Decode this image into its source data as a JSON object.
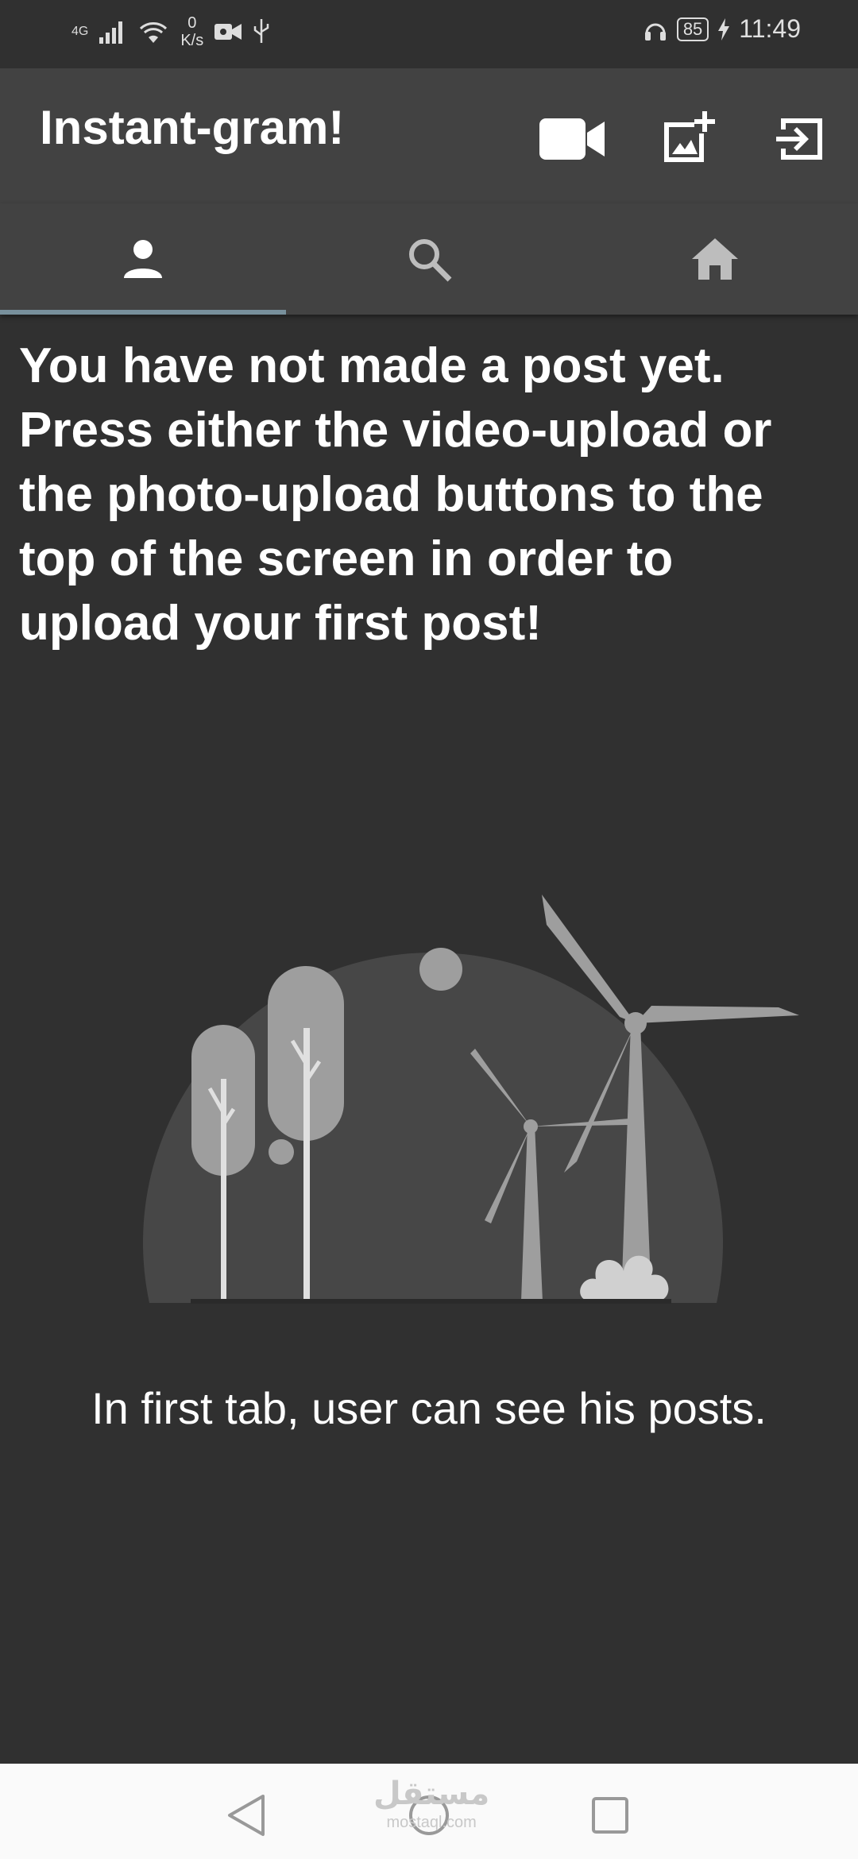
{
  "status_bar": {
    "network": "4G",
    "speed_value": "0",
    "speed_unit": "K/s",
    "battery": "85",
    "time": "11:49"
  },
  "app_bar": {
    "title": "Instant-gram!",
    "actions": [
      "videocam-icon",
      "add-photo-icon",
      "logout-icon"
    ]
  },
  "tabs": [
    {
      "icon": "person-icon",
      "active": true
    },
    {
      "icon": "search-icon",
      "active": false
    },
    {
      "icon": "home-icon",
      "active": false
    }
  ],
  "content": {
    "message": "You have not made a post yet. Press either the video-upload or the photo-upload buttons to the top of the screen in order to upload your first post!",
    "caption": "In first tab, user can see his posts."
  },
  "watermark": {
    "text": "مستقل",
    "sub": "mostaql.com"
  },
  "colors": {
    "background": "#303030",
    "app_bar": "#424242",
    "tab_indicator": "#78909c",
    "illustration": "#9e9e9e"
  }
}
